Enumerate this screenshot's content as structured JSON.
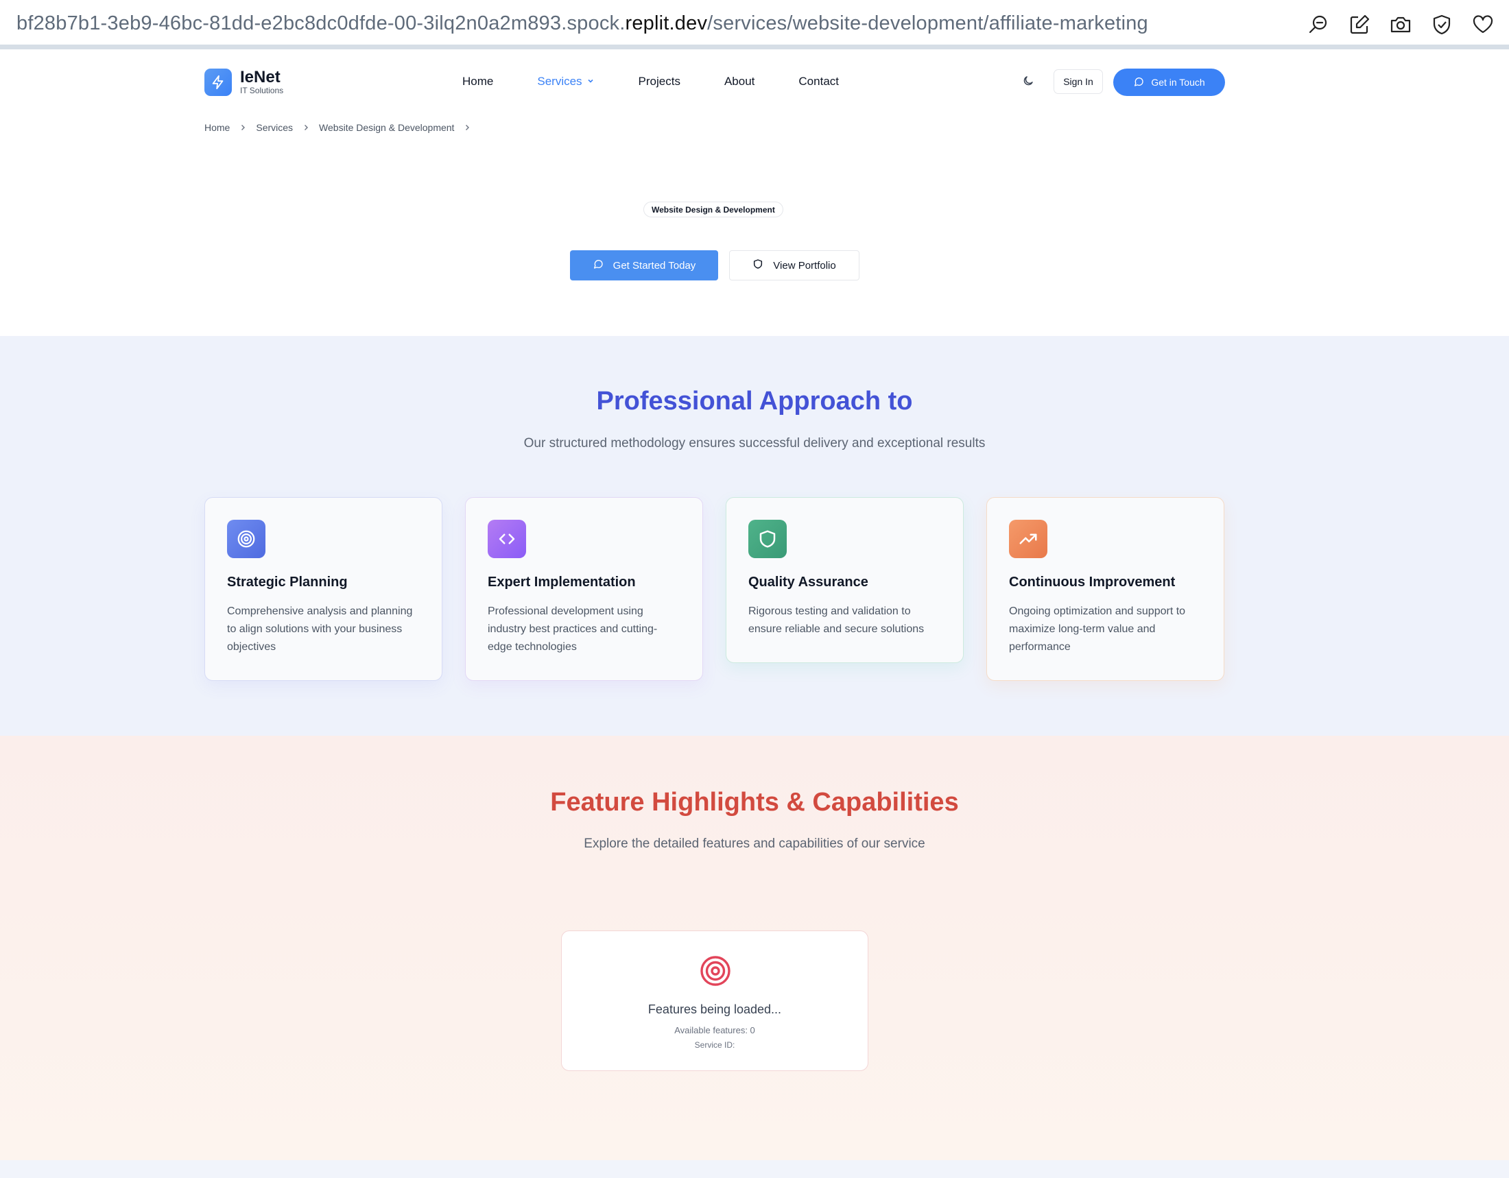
{
  "browser": {
    "url_prefix": "bf28b7b1-3eb9-46bc-81dd-e2bc8dc0dfde-00-3ilq2n0a2m893.spock.",
    "url_host": "replit.dev",
    "url_path": "/services/website-development/affiliate-marketing",
    "tools": [
      "zoom-icon",
      "edit-icon",
      "camera-icon",
      "shield-check-icon",
      "heart-icon"
    ]
  },
  "brand": {
    "name": "IeNet",
    "tagline": "IT Solutions",
    "accent": "#3b82f6"
  },
  "nav": {
    "items": [
      "Home",
      "Services",
      "Projects",
      "About",
      "Contact"
    ],
    "active": "Services",
    "signin_label": "Sign In",
    "cta_label": "Get in Touch"
  },
  "breadcrumb": [
    "Home",
    "Services",
    "Website Design & Development"
  ],
  "hero": {
    "badge": "Website Design & Development",
    "primary_label": "Get Started Today",
    "secondary_label": "View Portfolio"
  },
  "approach": {
    "title": "Professional Approach to",
    "subtitle": "Our structured methodology ensures successful delivery and exceptional results",
    "cards": [
      {
        "icon": "target-icon",
        "title": "Strategic Planning",
        "text": "Comprehensive analysis and planning to align solutions with your business objectives"
      },
      {
        "icon": "code-icon",
        "title": "Expert Implementation",
        "text": "Professional development using industry best practices and cutting-edge technologies"
      },
      {
        "icon": "shield-icon",
        "title": "Quality Assurance",
        "text": "Rigorous testing and validation to ensure reliable and secure solutions"
      },
      {
        "icon": "trending-up-icon",
        "title": "Continuous Improvement",
        "text": "Ongoing optimization and support to maximize long-term value and performance"
      }
    ]
  },
  "features": {
    "title": "Feature Highlights & Capabilities",
    "subtitle": "Explore the detailed features and capabilities of our service",
    "loading_text": "Features being loaded...",
    "available_text": "Available features: 0",
    "service_id_text": "Service ID:"
  },
  "colors": {
    "approach_title": "#4352d6",
    "features_title": "#d24a3f"
  }
}
